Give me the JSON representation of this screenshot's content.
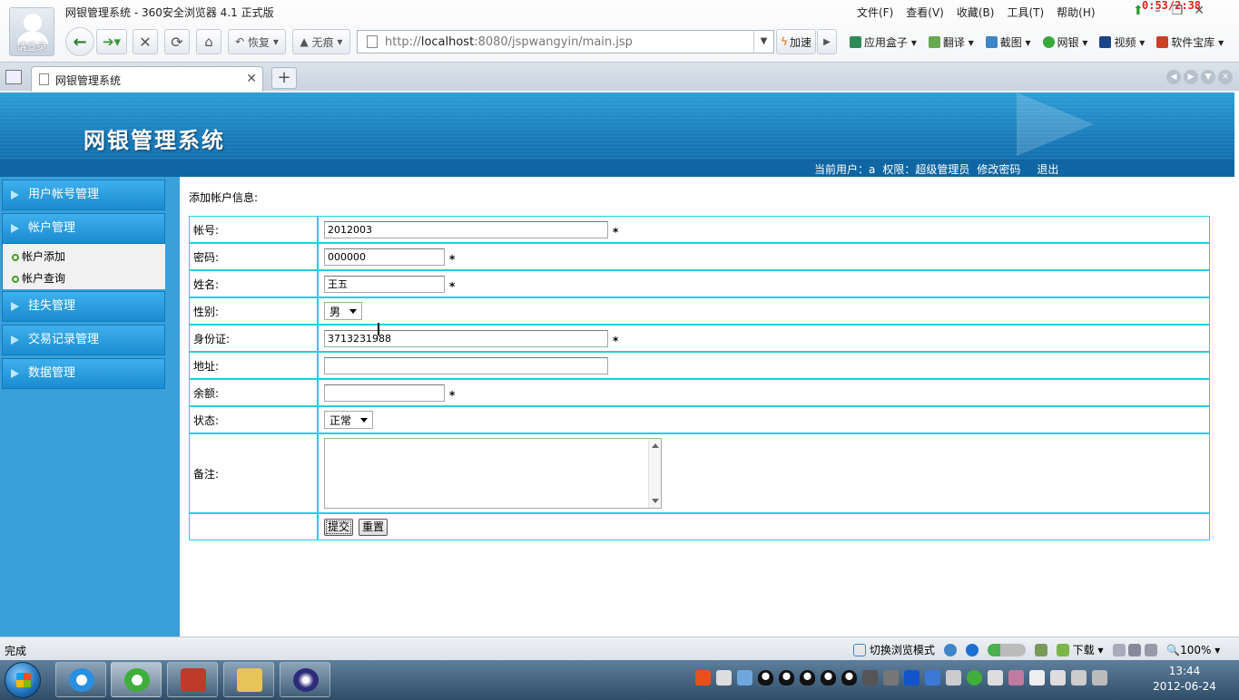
{
  "browser": {
    "avatar_label": "请登录",
    "window_title": "网银管理系统 - 360安全浏览器 4.1 正式版",
    "menus": [
      "文件(F)",
      "查看(V)",
      "收藏(B)",
      "工具(T)",
      "帮助(H)"
    ],
    "overlay_timer": "0:53/2:38",
    "restore_label": "恢复",
    "incognito_label": "无痕",
    "url_prefix": "http://",
    "url_host": "localhost",
    "url_rest": ":8080/jspwangyin/main.jsp",
    "speed_label": "加速",
    "plugins": [
      "应用盒子",
      "翻译",
      "截图",
      "网银",
      "视频",
      "软件宝库"
    ],
    "tab_title": "网银管理系统"
  },
  "header": {
    "system_title": "网银管理系统",
    "current_user_label": "当前用户：a",
    "permission_label": "权限：超级管理员",
    "change_password": "修改密码",
    "logout": "退出"
  },
  "sidebar": {
    "groups": [
      {
        "label": "用户帐号管理"
      },
      {
        "label": "帐户管理"
      },
      {
        "label": "挂失管理"
      },
      {
        "label": "交易记录管理"
      },
      {
        "label": "数据管理"
      }
    ],
    "subitems": [
      "帐户添加",
      "帐户查询"
    ]
  },
  "form": {
    "title": "添加帐户信息:",
    "fields": [
      {
        "label": "帐号:",
        "value": "2012003",
        "required": "*"
      },
      {
        "label": "密码:",
        "value": "000000",
        "required": "*"
      },
      {
        "label": "姓名:",
        "value": "王五",
        "required": "*"
      },
      {
        "label": "性别:",
        "value": "男"
      },
      {
        "label": "身份证:",
        "value": "3713231988",
        "required": "*"
      },
      {
        "label": "地址:",
        "value": ""
      },
      {
        "label": "余额:",
        "value": "",
        "required": "*"
      },
      {
        "label": "状态:",
        "value": "正常"
      },
      {
        "label": "备注:",
        "value": ""
      }
    ],
    "submit_label": "提交",
    "reset_label": "重置"
  },
  "statusbar": {
    "status": "完成",
    "mode_switch": "切换浏览模式",
    "download": "下载",
    "zoom": "100%"
  },
  "taskbar": {
    "time": "13:44",
    "date": "2012-06-24"
  },
  "colors": {
    "banner": "#1878b7",
    "sidebar": "#3aa0da",
    "table_border": "#1fcfe0"
  }
}
